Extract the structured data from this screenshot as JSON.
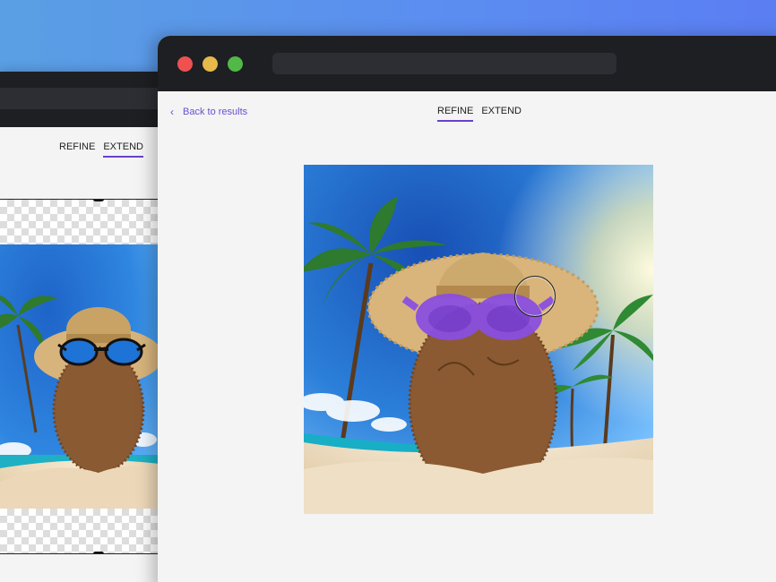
{
  "back_window": {
    "tabs": [
      {
        "label": "REFINE",
        "active": false
      },
      {
        "label": "EXTEND",
        "active": true
      }
    ]
  },
  "front_window": {
    "back_link": "Back to results",
    "tabs": [
      {
        "label": "REFINE",
        "active": true
      },
      {
        "label": "EXTEND",
        "active": false
      }
    ]
  },
  "colors": {
    "accent": "#6a3fcf",
    "titlebar": "#1e1f22",
    "mask_highlight": "#8a4fe0"
  },
  "icons": {
    "back": "chevron-left-icon",
    "brush": "brush-cursor-icon"
  }
}
